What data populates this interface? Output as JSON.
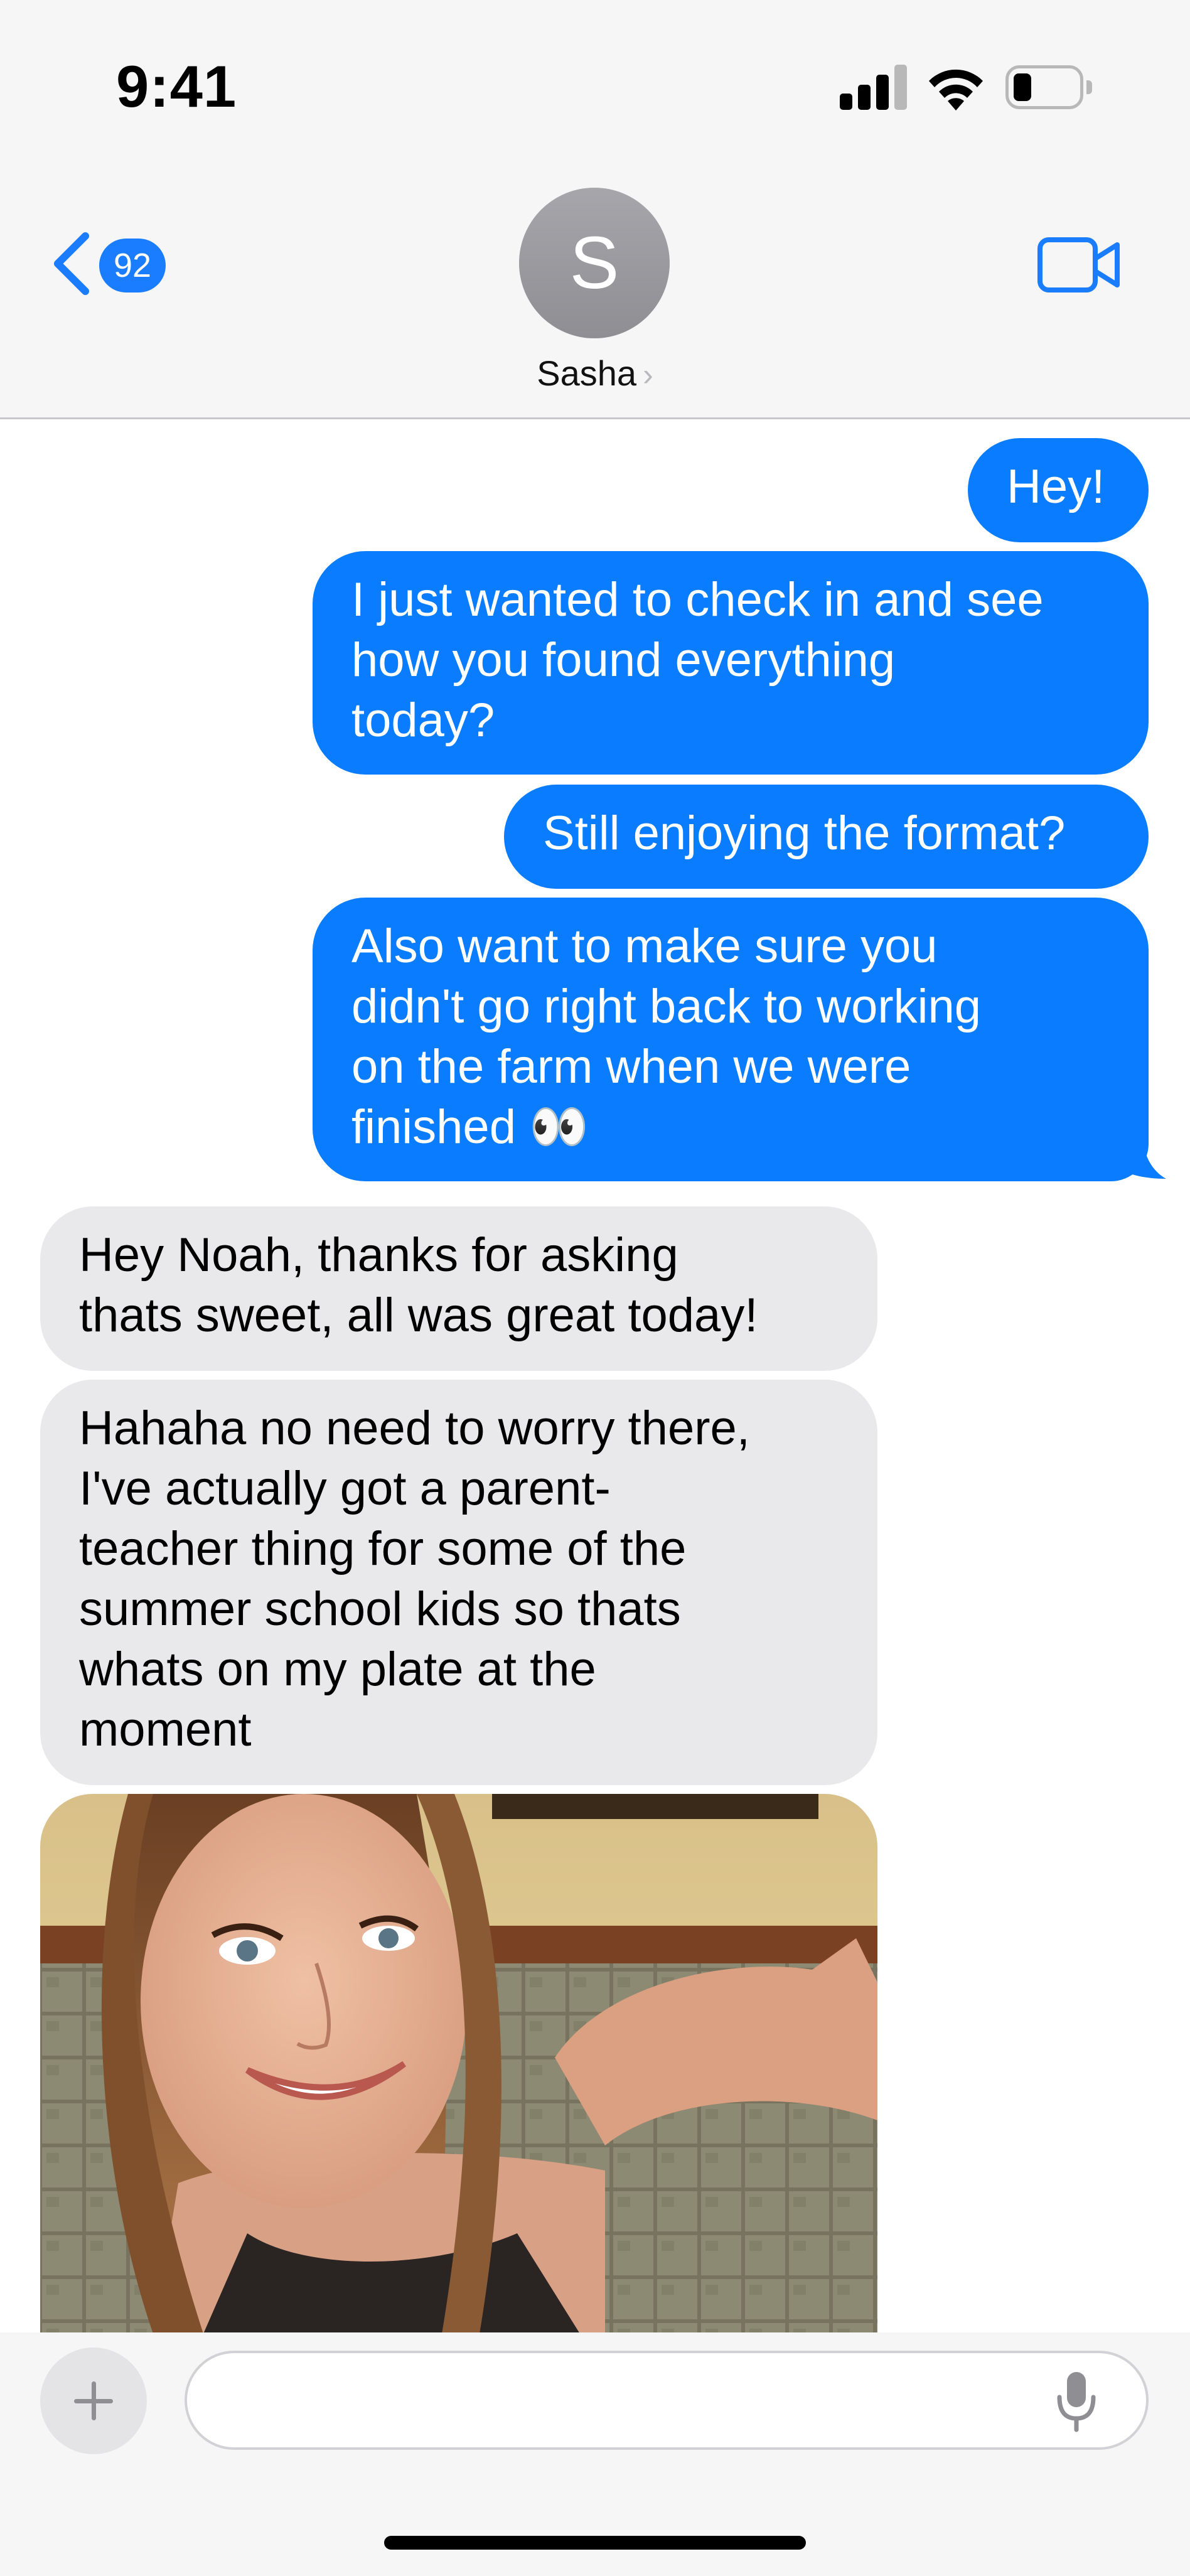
{
  "status_bar": {
    "time": "9:41",
    "icons": [
      "cellular-signal-icon",
      "wifi-icon",
      "battery-icon"
    ]
  },
  "header": {
    "back_badge_count": "92",
    "back_icon": "chevron-left-icon",
    "avatar_initial": "S",
    "contact_name": "Sasha",
    "contact_chevron": "›",
    "video_icon": "video-camera-icon"
  },
  "colors": {
    "sent_bubble": "#0a7cff",
    "received_bubble": "#e9e9eb",
    "accent": "#1a7cff"
  },
  "messages": [
    {
      "direction": "sent",
      "text": "Hey!"
    },
    {
      "direction": "sent",
      "text": "I just wanted to check in and see\nhow you found everything\ntoday?"
    },
    {
      "direction": "sent",
      "text": "Still enjoying the format?"
    },
    {
      "direction": "sent",
      "text": "Also want to make sure you\ndidn't go right back to working\non the farm when we were\nfinished 👀"
    },
    {
      "direction": "received",
      "text": "Hey Noah, thanks for asking\nthats sweet, all was great today!"
    },
    {
      "direction": "received",
      "text": "Hahaha no need to worry there,\nI've actually got a parent-\nteacher thing for some of the\nsummer school kids so thats\nwhats on my plate at the\nmoment"
    },
    {
      "direction": "received",
      "type": "photo",
      "icon": "photo-attachment"
    }
  ],
  "composer": {
    "placeholder": "",
    "value": "",
    "add_icon": "plus-icon",
    "mic_icon": "microphone-icon"
  }
}
